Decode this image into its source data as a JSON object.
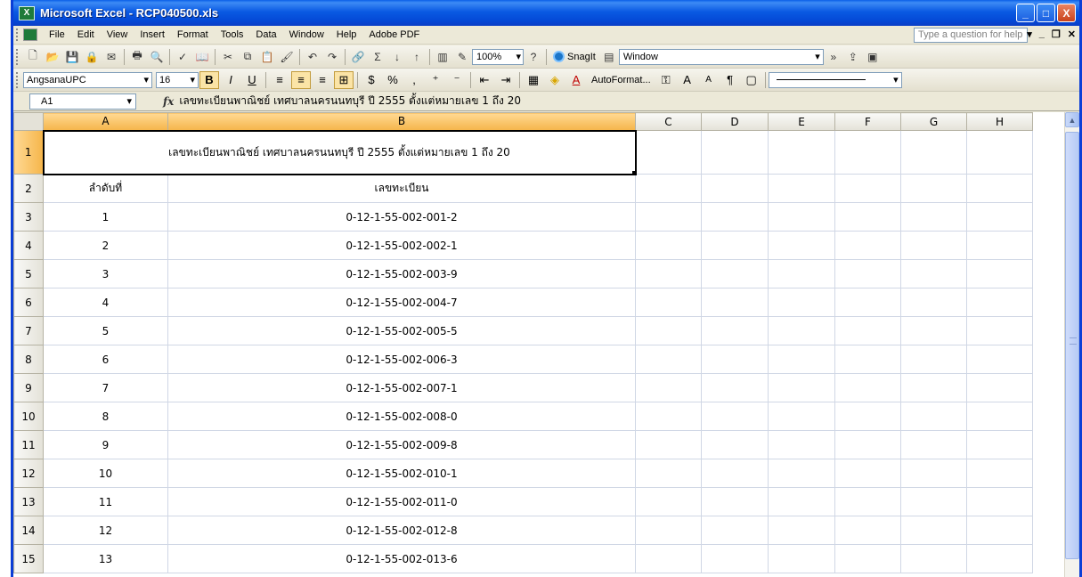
{
  "window": {
    "title": "Microsoft Excel - RCP040500.xls",
    "min": "_",
    "max": "□",
    "close": "X"
  },
  "menu": {
    "items": [
      "File",
      "Edit",
      "View",
      "Insert",
      "Format",
      "Tools",
      "Data",
      "Window",
      "Help",
      "Adobe PDF"
    ],
    "help_placeholder": "Type a question for help"
  },
  "toolbar": {
    "zoom": "100%",
    "snagit_label": "SnagIt",
    "window_combo": "Window",
    "font_name": "AngsanaUPC",
    "font_size": "16",
    "autoformat_label": "AutoFormat..."
  },
  "formula_bar": {
    "name_box": "A1",
    "fx": "fx",
    "formula": "เลขทะเบียนพาณิชย์ เทศบาลนครนนทบุรี ปี 2555 ตั้งแต่หมายเลข 1 ถึง 20"
  },
  "sheet": {
    "columns": [
      "A",
      "B",
      "C",
      "D",
      "E",
      "F",
      "G",
      "H"
    ],
    "title": "เลขทะเบียนพาณิชย์ เทศบาลนครนนทบุรี ปี 2555 ตั้งแต่หมายเลข 1 ถึง 20",
    "header": {
      "col_a": "ลำดับที่",
      "col_b": "เลขทะเบียน"
    },
    "rows": [
      {
        "num": "3",
        "a": "1",
        "b": "0-12-1-55-002-001-2"
      },
      {
        "num": "4",
        "a": "2",
        "b": "0-12-1-55-002-002-1"
      },
      {
        "num": "5",
        "a": "3",
        "b": "0-12-1-55-002-003-9"
      },
      {
        "num": "6",
        "a": "4",
        "b": "0-12-1-55-002-004-7"
      },
      {
        "num": "7",
        "a": "5",
        "b": "0-12-1-55-002-005-5"
      },
      {
        "num": "8",
        "a": "6",
        "b": "0-12-1-55-002-006-3"
      },
      {
        "num": "9",
        "a": "7",
        "b": "0-12-1-55-002-007-1"
      },
      {
        "num": "10",
        "a": "8",
        "b": "0-12-1-55-002-008-0"
      },
      {
        "num": "11",
        "a": "9",
        "b": "0-12-1-55-002-009-8"
      },
      {
        "num": "12",
        "a": "10",
        "b": "0-12-1-55-002-010-1"
      },
      {
        "num": "13",
        "a": "11",
        "b": "0-12-1-55-002-011-0"
      },
      {
        "num": "14",
        "a": "12",
        "b": "0-12-1-55-002-012-8"
      },
      {
        "num": "15",
        "a": "13",
        "b": "0-12-1-55-002-013-6"
      }
    ]
  },
  "colors": {
    "titlebar": "#0a5ae3",
    "selected_header": "#f5b54a",
    "gridline": "#d0d7e5"
  }
}
